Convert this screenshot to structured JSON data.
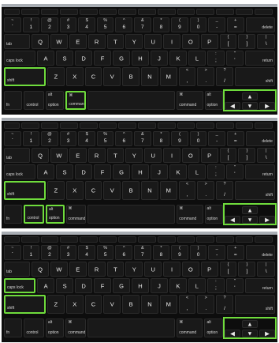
{
  "keyboard": {
    "number_row": [
      {
        "top": "~",
        "main": "`"
      },
      {
        "top": "!",
        "main": "1"
      },
      {
        "top": "@",
        "main": "2"
      },
      {
        "top": "#",
        "main": "3"
      },
      {
        "top": "$",
        "main": "4"
      },
      {
        "top": "%",
        "main": "5"
      },
      {
        "top": "^",
        "main": "6"
      },
      {
        "top": "&",
        "main": "7"
      },
      {
        "top": "*",
        "main": "8"
      },
      {
        "top": "(",
        "main": "9"
      },
      {
        "top": ")",
        "main": "0"
      },
      {
        "top": "_",
        "main": "-"
      },
      {
        "top": "+",
        "main": "="
      }
    ],
    "delete_label": "delete",
    "tab_label": "tab",
    "qwerty_row": [
      "Q",
      "W",
      "E",
      "R",
      "T",
      "Y",
      "U",
      "I",
      "O",
      "P"
    ],
    "bracket_keys": [
      {
        "top": "{",
        "main": "["
      },
      {
        "top": "}",
        "main": "]"
      },
      {
        "top": "|",
        "main": "\\"
      }
    ],
    "caps_label": "caps lock",
    "home_row": [
      "A",
      "S",
      "D",
      "F",
      "G",
      "H",
      "J",
      "K",
      "L"
    ],
    "punct_home": [
      {
        "top": ":",
        "main": ";"
      },
      {
        "top": "\"",
        "main": "'"
      }
    ],
    "return_label": "return",
    "shift_label": "shift",
    "bottom_row_letters": [
      "Z",
      "X",
      "C",
      "V",
      "B",
      "N",
      "M"
    ],
    "punct_bottom": [
      {
        "top": "<",
        "main": ","
      },
      {
        "top": ">",
        "main": "."
      },
      {
        "top": "?",
        "main": "/"
      }
    ],
    "fn_label": "fn",
    "control_label": "control",
    "option_label": "option",
    "command_label": "command",
    "cmd_symbol": "⌘",
    "alt_symbol": "alt",
    "arrow_up": "▲",
    "arrow_down": "▼",
    "arrow_left": "◀",
    "arrow_right": "▶"
  },
  "panels": [
    {
      "highlights": [
        "left-shift",
        "command-left",
        "arrows"
      ],
      "highlight_color": "#6fdc3c"
    },
    {
      "highlights": [
        "left-shift",
        "control",
        "option-left",
        "arrows"
      ],
      "highlight_color": "#6fdc3c"
    },
    {
      "highlights": [
        "caps-lock",
        "left-shift",
        "arrows"
      ],
      "highlight_color": "#6fdc3c"
    }
  ],
  "colors": {
    "key": "#191919",
    "background": "#0d0d0d",
    "frame": "#a9aeb4",
    "highlight": "#6fdc3c"
  }
}
